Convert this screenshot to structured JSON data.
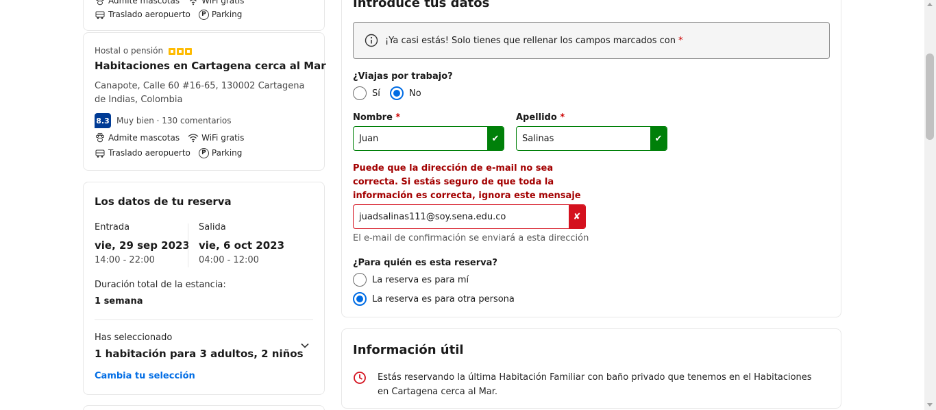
{
  "top_card": {
    "amenities_row1": [
      "Admite mascotas",
      "WiFi gratis"
    ],
    "amenities_row2": [
      "Traslado aeropuerto",
      "Parking"
    ]
  },
  "hotel_card": {
    "type": "Hostal o pensión",
    "stars": 3,
    "name": "Habitaciones en Cartagena cerca al Mar",
    "address": "Canapote, Calle 60 #16-65, 130002 Cartagena de Indias, Colombia",
    "score": "8.3",
    "score_text": "Muy bien · 130 comentarios",
    "amenities_row1": [
      "Admite mascotas",
      "WiFi gratis"
    ],
    "amenities_row2": [
      "Traslado aeropuerto",
      "Parking"
    ]
  },
  "booking": {
    "title": "Los datos de tu reserva",
    "checkin_label": "Entrada",
    "checkin_date": "vie, 29 sep 2023",
    "checkin_time": "14:00 - 22:00",
    "checkout_label": "Salida",
    "checkout_date": "vie, 6 oct 2023",
    "checkout_time": "04:00 - 12:00",
    "duration_label": "Duración total de la estancia:",
    "duration_value": "1 semana",
    "selected_label": "Has seleccionado",
    "selected_value": "1 habitación para 3 adultos, 2 niños",
    "change_link": "Cambia tu selección"
  },
  "form": {
    "title": "Introduce tus datos",
    "notice": "¡Ya casi estás! Solo tienes que rellenar los campos marcados con",
    "required_mark": "*",
    "work_question": "¿Viajas por trabajo?",
    "work_options": [
      "Sí",
      "No"
    ],
    "work_selected": "No",
    "first_name_label": "Nombre",
    "first_name_value": "Juan",
    "last_name_label": "Apellido",
    "last_name_value": "Salinas",
    "email_error": "Puede que la dirección de e-mail no sea correcta. Si estás seguro de que toda la información es correcta, ignora este mensaje",
    "email_value": "juadsalinas111@soy.sena.edu.co",
    "email_help": "El e-mail de confirmación se enviará a esta dirección",
    "for_whom_question": "¿Para quién es esta reserva?",
    "for_whom_options": [
      "La reserva es para mí",
      "La reserva es para otra persona"
    ],
    "for_whom_selected": "La reserva es para otra persona"
  },
  "info": {
    "title": "Información útil",
    "text": "Estás reservando la última Habitación Familiar con baño privado que tenemos en el Habitaciones en Cartagena cerca al Mar."
  },
  "colors": {
    "primary": "#006ce4",
    "brand_dark": "#003b95",
    "success": "#008009",
    "error": "#d4111e",
    "error_text": "#a30000",
    "star": "#febb02"
  }
}
